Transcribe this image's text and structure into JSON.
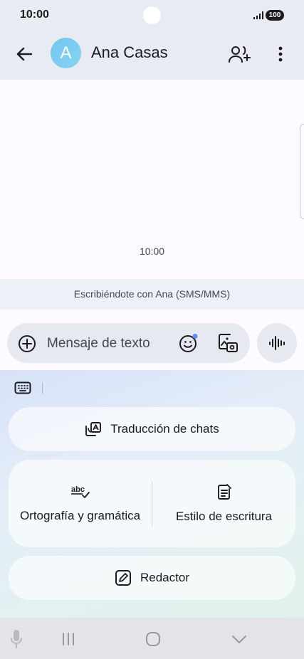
{
  "status_bar": {
    "time": "10:00",
    "battery": "100"
  },
  "app_bar": {
    "avatar_letter": "A",
    "contact_name": "Ana Casas",
    "icons": [
      "back-arrow-icon",
      "add-person-icon",
      "more-vert-icon"
    ]
  },
  "conversation": {
    "message_time": "10:00",
    "info_text": "Escribiéndote con Ana (SMS/MMS)"
  },
  "compose": {
    "placeholder": "Mensaje de texto",
    "icons": [
      "add-circle-icon",
      "emoji-icon",
      "gallery-icon",
      "voice-waveform-icon"
    ]
  },
  "ai_panel": {
    "translate_label": "Traducción de chats",
    "spelling_label": "Ortografía y gramática",
    "style_label": "Estilo de escritura",
    "writer_label": "Redactor",
    "icons": [
      "keyboard-icon",
      "translate-icon",
      "spellcheck-icon",
      "writing-style-icon",
      "edit-icon"
    ]
  },
  "colors": {
    "accent": "#5b8bf5",
    "avatar": "#78cbef",
    "surface": "#e9ebf3"
  }
}
